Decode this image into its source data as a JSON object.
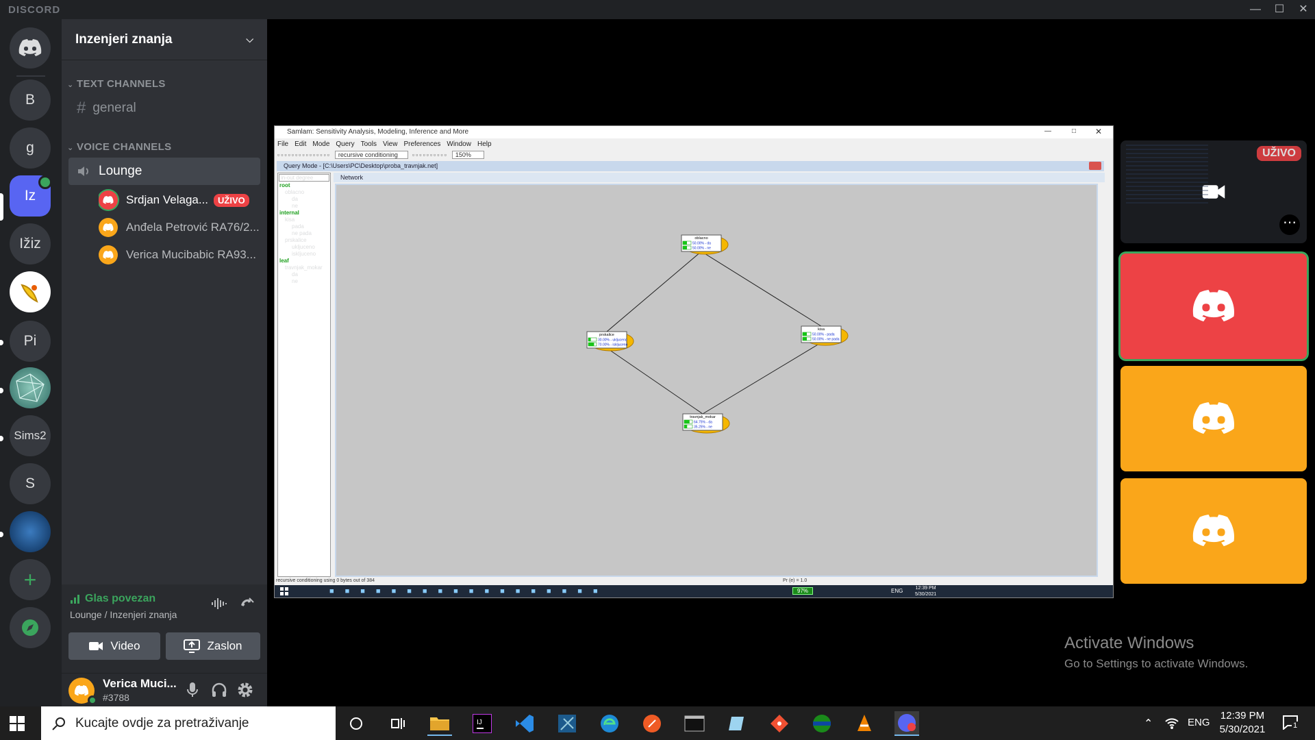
{
  "app": {
    "brand": "DISCORD"
  },
  "guilds": [
    {
      "label": "B"
    },
    {
      "label": "g"
    },
    {
      "label": "Iz"
    },
    {
      "label": "Ižiz"
    },
    {
      "label": ""
    },
    {
      "label": "Pi"
    },
    {
      "label": ""
    },
    {
      "label": "Sims2"
    },
    {
      "label": "S"
    },
    {
      "label": ""
    }
  ],
  "server": {
    "name": "Inzenjeri znanja",
    "text_category": "TEXT CHANNELS",
    "text_channels": [
      {
        "name": "general"
      }
    ],
    "voice_category": "VOICE CHANNELS",
    "voice_channel": "Lounge",
    "voice_users": [
      {
        "name": "Srdjan Velaga...",
        "badge": "UŽIVO"
      },
      {
        "name": "Anđela Petrović RA76/2..."
      },
      {
        "name": "Verica Mucibabic RA93..."
      }
    ]
  },
  "voice_panel": {
    "status": "Glas povezan",
    "location": "Lounge / Inzenjeri znanja",
    "video_label": "Video",
    "screen_label": "Zaslon"
  },
  "user": {
    "name": "Verica Muci...",
    "tag": "#3788"
  },
  "stream": {
    "window_title": "Samlam: Sensitivity Analysis, Modeling, Inference and More",
    "menu": [
      "File",
      "Edit",
      "Mode",
      "Query",
      "Tools",
      "View",
      "Preferences",
      "Window",
      "Help"
    ],
    "algo": "recursive conditioning",
    "zoom": "150%",
    "subwindow_title": "Query Mode - [C:\\Users\\PC\\Desktop\\proba_travnjak.net]",
    "tree_filter": "in-out degree",
    "tree": [
      {
        "text": "root",
        "kind": "head"
      },
      {
        "text": "oblacno",
        "kind": "node"
      },
      {
        "text": "da",
        "kind": "state"
      },
      {
        "text": "ne",
        "kind": "state"
      },
      {
        "text": "internal",
        "kind": "head"
      },
      {
        "text": "kisa",
        "kind": "node"
      },
      {
        "text": "pada",
        "kind": "state"
      },
      {
        "text": "ne pada",
        "kind": "state"
      },
      {
        "text": "prskalice",
        "kind": "node"
      },
      {
        "text": "ukljuceno",
        "kind": "state"
      },
      {
        "text": "iskljuceno",
        "kind": "state"
      },
      {
        "text": "leaf",
        "kind": "head"
      },
      {
        "text": "travnjak_mokar",
        "kind": "node"
      },
      {
        "text": "da",
        "kind": "state"
      },
      {
        "text": "ne",
        "kind": "state"
      }
    ],
    "network_title": "Network",
    "nodes": [
      {
        "name": "oblacno",
        "rows": [
          "50.00% - da",
          "50.00% - ne"
        ],
        "probs": [
          0.5,
          0.5
        ]
      },
      {
        "name": "prskalice",
        "rows": [
          "30.00% - ukljuceno",
          "70.00% - iskljuceno"
        ],
        "probs": [
          0.3,
          0.7
        ]
      },
      {
        "name": "kisa",
        "rows": [
          "50.00% - pada",
          "50.00% - ne pada"
        ],
        "probs": [
          0.5,
          0.5
        ]
      },
      {
        "name": "travnjak_mokar",
        "rows": [
          "64.75% - da",
          "35.25% - ne"
        ],
        "probs": [
          0.6475,
          0.3525
        ]
      }
    ],
    "status_left": "recursive conditioning using 0 bytes out of 384",
    "status_right": "Pr (e) = 1.0",
    "inner_taskbar": {
      "battery": "97%",
      "lang": "ENG",
      "time": "12:39 PM",
      "date": "5/30/2021"
    }
  },
  "preview": {
    "live_badge": "UŽIVO"
  },
  "watermark": {
    "title": "Activate Windows",
    "subtitle": "Go to Settings to activate Windows."
  },
  "taskbar": {
    "search_placeholder": "Kucajte ovdje za pretraživanje",
    "lang": "ENG",
    "time": "12:39 PM",
    "date": "5/30/2021",
    "notif_count": "1"
  },
  "colors": {
    "blurple": "#5865f2",
    "red": "#ed4245",
    "orange": "#faa61a",
    "green": "#3ba55d"
  }
}
